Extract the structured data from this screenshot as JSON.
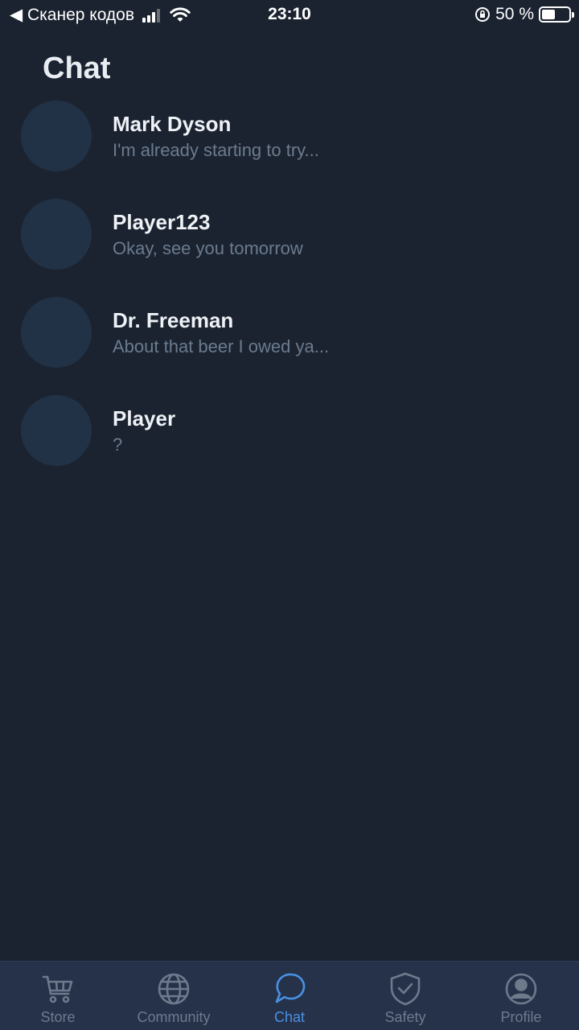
{
  "status_bar": {
    "back_label": "◀ Сканер кодов",
    "time": "23:10",
    "battery_text": "50 %",
    "battery_level": 0.5
  },
  "page": {
    "title": "Chat"
  },
  "chats": [
    {
      "name": "Mark Dyson",
      "preview": "I'm already starting to try..."
    },
    {
      "name": "Player123",
      "preview": "Okay, see you tomorrow"
    },
    {
      "name": "Dr. Freeman",
      "preview": "About that beer I owed ya..."
    },
    {
      "name": "Player",
      "preview": "?"
    }
  ],
  "nav": {
    "items": [
      {
        "label": "Store",
        "icon": "cart-icon"
      },
      {
        "label": "Community",
        "icon": "globe-icon"
      },
      {
        "label": "Chat",
        "icon": "chat-bubble-icon",
        "active": true
      },
      {
        "label": "Safety",
        "icon": "shield-check-icon"
      },
      {
        "label": "Profile",
        "icon": "user-circle-icon"
      }
    ]
  },
  "colors": {
    "background": "#1b2330",
    "nav_background": "#26324a",
    "accent": "#4a90e2",
    "muted": "#6d7a8c",
    "avatar": "#223246"
  }
}
